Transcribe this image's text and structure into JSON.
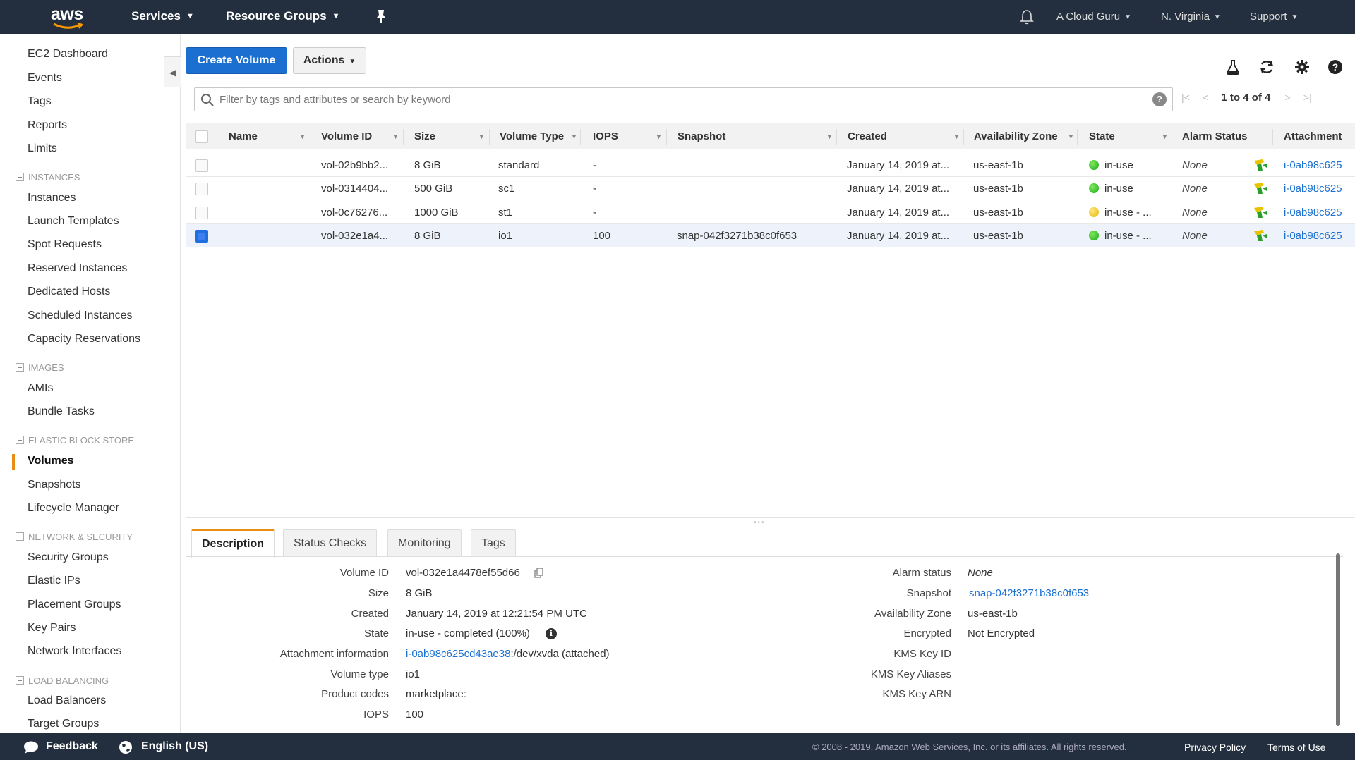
{
  "topnav": {
    "logo_text": "aws",
    "services": "Services",
    "resource_groups": "Resource Groups",
    "account": "A Cloud Guru",
    "region": "N. Virginia",
    "support": "Support"
  },
  "sidebar": {
    "top_items": [
      "EC2 Dashboard",
      "Events",
      "Tags",
      "Reports",
      "Limits"
    ],
    "sections": [
      {
        "title": "INSTANCES",
        "items": [
          "Instances",
          "Launch Templates",
          "Spot Requests",
          "Reserved Instances",
          "Dedicated Hosts",
          "Scheduled Instances",
          "Capacity Reservations"
        ]
      },
      {
        "title": "IMAGES",
        "items": [
          "AMIs",
          "Bundle Tasks"
        ]
      },
      {
        "title": "ELASTIC BLOCK STORE",
        "items": [
          "Volumes",
          "Snapshots",
          "Lifecycle Manager"
        ]
      },
      {
        "title": "NETWORK & SECURITY",
        "items": [
          "Security Groups",
          "Elastic IPs",
          "Placement Groups",
          "Key Pairs",
          "Network Interfaces"
        ]
      },
      {
        "title": "LOAD BALANCING",
        "items": [
          "Load Balancers",
          "Target Groups"
        ]
      }
    ],
    "active_item": "Volumes"
  },
  "toolbar": {
    "create_label": "Create Volume",
    "actions_label": "Actions"
  },
  "filter": {
    "placeholder": "Filter by tags and attributes or search by keyword",
    "help": "?"
  },
  "pager": {
    "text": "1 to 4 of 4"
  },
  "table": {
    "columns": [
      "Name",
      "Volume ID",
      "Size",
      "Volume Type",
      "IOPS",
      "Snapshot",
      "Created",
      "Availability Zone",
      "State",
      "Alarm Status",
      "Attachment"
    ],
    "rows": [
      {
        "name": "",
        "volume_id": "vol-02b9bb2...",
        "size": "8 GiB",
        "type": "standard",
        "iops": "-",
        "snapshot": "",
        "created": "January 14, 2019 at...",
        "az": "us-east-1b",
        "state": "in-use",
        "state_color": "green",
        "alarm": "None",
        "attachment": "i-0ab98c625",
        "selected": false
      },
      {
        "name": "",
        "volume_id": "vol-0314404...",
        "size": "500 GiB",
        "type": "sc1",
        "iops": "-",
        "snapshot": "",
        "created": "January 14, 2019 at...",
        "az": "us-east-1b",
        "state": "in-use",
        "state_color": "green",
        "alarm": "None",
        "attachment": "i-0ab98c625",
        "selected": false
      },
      {
        "name": "",
        "volume_id": "vol-0c76276...",
        "size": "1000 GiB",
        "type": "st1",
        "iops": "-",
        "snapshot": "",
        "created": "January 14, 2019 at...",
        "az": "us-east-1b",
        "state": "in-use - ...",
        "state_color": "yellow",
        "alarm": "None",
        "attachment": "i-0ab98c625",
        "selected": false
      },
      {
        "name": "",
        "volume_id": "vol-032e1a4...",
        "size": "8 GiB",
        "type": "io1",
        "iops": "100",
        "snapshot": "snap-042f3271b38c0f653",
        "created": "January 14, 2019 at...",
        "az": "us-east-1b",
        "state": "in-use - ...",
        "state_color": "green",
        "alarm": "None",
        "attachment": "i-0ab98c625",
        "selected": true
      }
    ]
  },
  "detail": {
    "tabs": [
      "Description",
      "Status Checks",
      "Monitoring",
      "Tags"
    ],
    "active_tab": "Description",
    "left": [
      {
        "label": "Volume ID",
        "value": "vol-032e1a4478ef55d66"
      },
      {
        "label": "Size",
        "value": "8 GiB"
      },
      {
        "label": "Created",
        "value": "January 14, 2019 at 12:21:54 PM UTC"
      },
      {
        "label": "State",
        "value": "in-use - completed (100%)"
      },
      {
        "label": "Attachment information",
        "value_link": "i-0ab98c625cd43ae38",
        "value_rest": ":/dev/xvda (attached)"
      },
      {
        "label": "Volume type",
        "value": "io1"
      },
      {
        "label": "Product codes",
        "value": "marketplace:"
      },
      {
        "label": "IOPS",
        "value": "100"
      }
    ],
    "right": [
      {
        "label": "Alarm status",
        "value": "None"
      },
      {
        "label": "Snapshot",
        "value": "snap-042f3271b38c0f653"
      },
      {
        "label": "Availability Zone",
        "value": "us-east-1b"
      },
      {
        "label": "Encrypted",
        "value": "Not Encrypted"
      },
      {
        "label": "KMS Key ID",
        "value": ""
      },
      {
        "label": "KMS Key Aliases",
        "value": ""
      },
      {
        "label": "KMS Key ARN",
        "value": ""
      }
    ]
  },
  "footer": {
    "feedback": "Feedback",
    "language": "English (US)",
    "copyright": "© 2008 - 2019, Amazon Web Services, Inc. or its affiliates. All rights reserved.",
    "privacy": "Privacy Policy",
    "terms": "Terms of Use"
  },
  "colors": {
    "nav_bg": "#232f3e",
    "primary": "#1a6fd1",
    "active_accent": "#e88e15",
    "state_green": "#1da71a",
    "state_yellow": "#e8b40b"
  }
}
